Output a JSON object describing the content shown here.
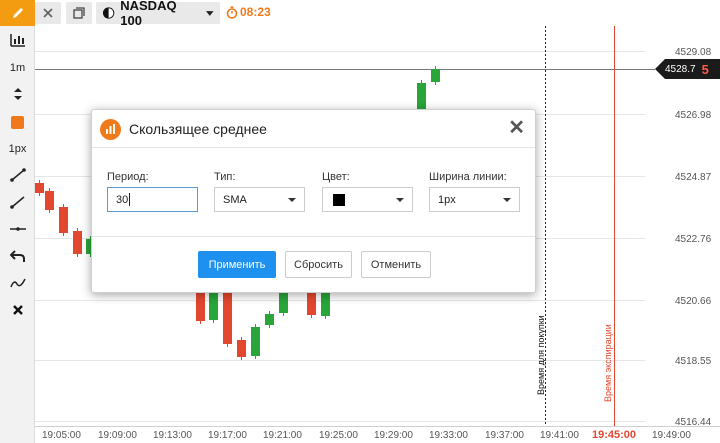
{
  "sidebar": {
    "items": [
      {
        "icon": "pencil-icon"
      },
      {
        "icon": "chart-type-icon"
      },
      {
        "label": "1m"
      },
      {
        "icon": "up-down-arrows-icon"
      },
      {
        "icon": "color-square-icon"
      },
      {
        "label": "1px"
      },
      {
        "icon": "trend-line-icon"
      },
      {
        "icon": "ray-line-icon"
      },
      {
        "icon": "horizontal-line-icon"
      },
      {
        "icon": "undo-icon"
      },
      {
        "icon": "indicator-icon"
      },
      {
        "icon": "close-icon"
      }
    ]
  },
  "topbar": {
    "asset": "NASDAQ 100",
    "timer": "08:23"
  },
  "chart": {
    "price_labels": [
      "4529.08",
      "4526.98",
      "4524.87",
      "4522.76",
      "4520.66",
      "4518.55",
      "4516.44"
    ],
    "time_labels": [
      "19:05:00",
      "19:09:00",
      "19:13:00",
      "19:17:00",
      "19:21:00",
      "19:25:00",
      "19:29:00",
      "19:33:00",
      "19:37:00",
      "19:41:00",
      "19:45:00",
      "19:49:00"
    ],
    "current_price": "4528.7",
    "countdown": "5",
    "purchase_label": "Время для покупки",
    "expiry_label": "Время экспирации",
    "colors": {
      "up": "#2aa53a",
      "down": "#e2472f",
      "expiry": "#e2472f"
    }
  },
  "modal": {
    "title": "Скользящее среднее",
    "period_label": "Период:",
    "period_value": "30",
    "type_label": "Тип:",
    "type_value": "SMA",
    "color_label": "Цвет:",
    "color_value": "#000000",
    "width_label": "Ширина линии:",
    "width_value": "1px",
    "apply": "Применить",
    "reset": "Сбросить",
    "cancel": "Отменить"
  }
}
